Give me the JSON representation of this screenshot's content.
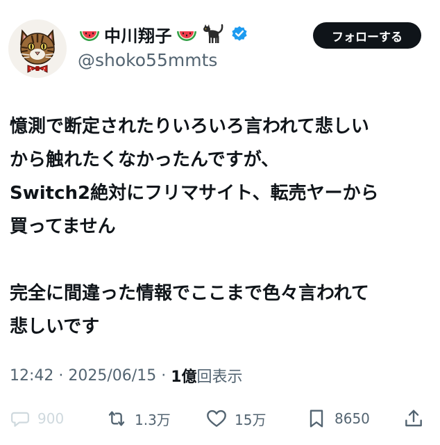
{
  "author": {
    "display_name": "中川翔子",
    "handle": "@shoko55mmts",
    "name_emojis": [
      "watermelon-icon",
      "watermelon-icon",
      "black-cat-icon"
    ],
    "verified": true,
    "verified_color": "#1d9bf0"
  },
  "follow_button": {
    "label": "フォローする"
  },
  "tweet": {
    "lines": [
      "憶測で断定されたりいろいろ言われて悲しい",
      "から触れたくなかったんですが、",
      "Switch2絶対にフリマサイト、転売ヤーから",
      "買ってません",
      "",
      "完全に間違った情報でここまで色々言われて",
      "悲しいです"
    ]
  },
  "meta": {
    "time": "12:42",
    "sep1": " · ",
    "date": "2025/06/15",
    "sep2": " · ",
    "views_count": "1億",
    "views_label": "回表示"
  },
  "actions": {
    "reply": {
      "icon": "reply-icon",
      "count": "900"
    },
    "repost": {
      "icon": "repost-icon",
      "count": "1.3万"
    },
    "like": {
      "icon": "heart-icon",
      "count": "15万"
    },
    "bookmark": {
      "icon": "bookmark-icon",
      "count": "8650"
    },
    "share": {
      "icon": "share-icon"
    }
  },
  "colors": {
    "text": "#0f1419",
    "secondary": "#536471",
    "disabled": "#cfd9de",
    "follow_bg": "#0f1419",
    "verified": "#1d9bf0"
  }
}
